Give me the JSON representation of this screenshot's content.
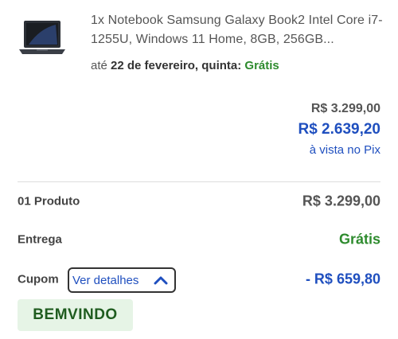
{
  "product": {
    "name": "1x Notebook Samsung Galaxy Book2 Intel Core i7-1255U, Windows 11 Home, 8GB, 256GB...",
    "delivery_prefix": "até",
    "delivery_date": "22 de fevereiro, quinta:",
    "delivery_cost": "Grátis"
  },
  "prices": {
    "original": "R$ 3.299,00",
    "discounted": "R$ 2.639,20",
    "payment_note": "à vista no Pix"
  },
  "summary": {
    "products_label": "01 Produto",
    "products_value": "R$ 3.299,00",
    "delivery_label": "Entrega",
    "delivery_value": "Grátis",
    "coupon_label": "Cupom",
    "coupon_details_label": "Ver detalhes",
    "coupon_value": "- R$ 659,80",
    "coupon_code": "BEMVINDO"
  },
  "colors": {
    "accent_blue": "#1f4fbf",
    "success_green": "#2e8b2e",
    "coupon_bg": "#e6f4e6"
  },
  "icons": {
    "details_toggle": "chevron-up-icon",
    "product_image": "laptop-thumbnail"
  }
}
